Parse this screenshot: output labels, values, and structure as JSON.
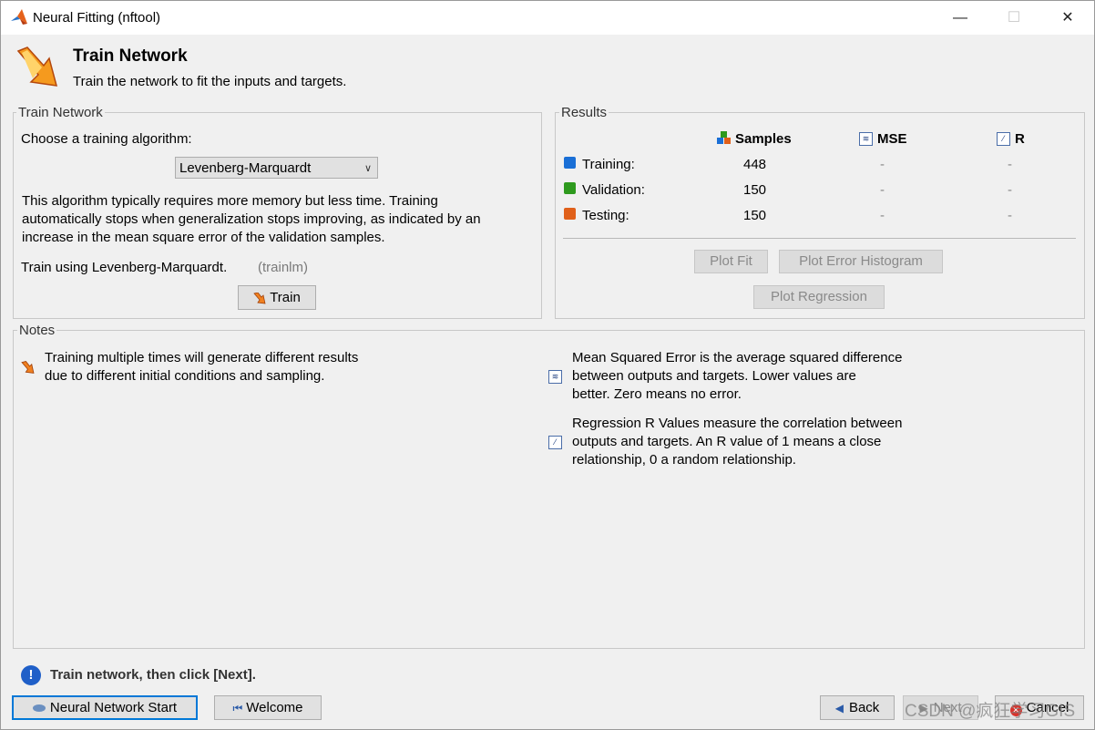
{
  "window": {
    "title": "Neural Fitting (nftool)",
    "minimize": "—",
    "maximize": "☐",
    "close": "✕"
  },
  "header": {
    "title": "Train Network",
    "subtitle": "Train the network to fit the inputs and targets."
  },
  "train_panel": {
    "legend": "Train Network",
    "choose_label": "Choose a training algorithm:",
    "algorithm": "Levenberg-Marquardt",
    "description": [
      "This algorithm typically requires more memory but less time. Training",
      "automatically stops when generalization stops improving, as indicated by an",
      "increase in the mean square error of the validation samples."
    ],
    "train_using": "Train using Levenberg-Marquardt.",
    "train_fn": "(trainlm)",
    "train_button": "Train"
  },
  "results": {
    "legend": "Results",
    "columns": {
      "samples": "Samples",
      "mse": "MSE",
      "r": "R"
    },
    "rows": [
      {
        "label": "Training:",
        "samples": "448",
        "mse": "-",
        "r": "-",
        "color": "#1a6fd6"
      },
      {
        "label": "Validation:",
        "samples": "150",
        "mse": "-",
        "r": "-",
        "color": "#2e9a1e"
      },
      {
        "label": "Testing:",
        "samples": "150",
        "mse": "-",
        "r": "-",
        "color": "#e0601a"
      }
    ],
    "plot_fit": "Plot Fit",
    "plot_error_histogram": "Plot Error Histogram",
    "plot_regression": "Plot Regression"
  },
  "notes": {
    "legend": "Notes",
    "note1": [
      "Training multiple times will generate different results",
      "due to different initial conditions and sampling."
    ],
    "note2": [
      "Mean Squared Error is the average squared difference",
      "between outputs and targets. Lower values are",
      "better. Zero means no error."
    ],
    "note3": [
      "Regression R Values measure the correlation between",
      "outputs and targets. An R value of 1 means a close",
      "relationship, 0 a random relationship."
    ]
  },
  "status": {
    "message": "Train network, then click [Next]."
  },
  "footer": {
    "neural_network_start": "Neural Network Start",
    "welcome": "Welcome",
    "back": "Back",
    "next": "Next",
    "cancel": "Cancel"
  },
  "watermark": "CSDN @疯狂学习GIS"
}
